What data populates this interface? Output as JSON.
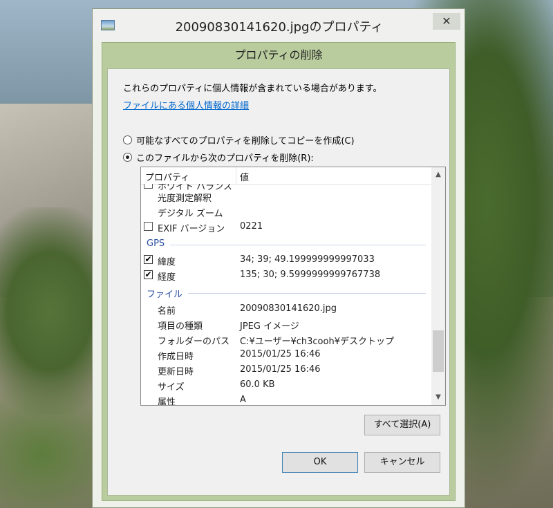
{
  "window": {
    "title": "20090830141620.jpgのプロパティ",
    "close_glyph": "✕"
  },
  "dialog": {
    "header": "プロパティの削除",
    "info_text": "これらのプロパティに個人情報が含まれている場合があります。",
    "details_link": "ファイルにある個人情報の詳細",
    "radio_copy": "可能なすべてのプロパティを削除してコピーを作成(C)",
    "radio_remove": "このファイルから次のプロパティを削除(R):",
    "selected_radio": "remove"
  },
  "list": {
    "col_property": "プロパティ",
    "col_value": "値",
    "partial_top_row": "ホワイト バランス",
    "rows_top": [
      {
        "name": "光度測定解釈",
        "value": "",
        "checkbox": false
      },
      {
        "name": "デジタル ズーム",
        "value": "",
        "checkbox": false
      },
      {
        "name": "EXIF バージョン",
        "value": "0221",
        "checkbox": true,
        "checked": false
      }
    ],
    "group_gps": "GPS",
    "rows_gps": [
      {
        "name": "緯度",
        "value": "34; 39; 49.199999999997033",
        "checked": true
      },
      {
        "name": "経度",
        "value": "135; 30; 9.5999999999767738",
        "checked": true
      }
    ],
    "group_file": "ファイル",
    "rows_file": [
      {
        "name": "名前",
        "value": "20090830141620.jpg"
      },
      {
        "name": "項目の種類",
        "value": "JPEG イメージ"
      },
      {
        "name": "フォルダーのパス",
        "value": "C:¥ユーザー¥ch3cooh¥デスクトップ"
      },
      {
        "name": "作成日時",
        "value": "2015/01/25 16:46"
      },
      {
        "name": "更新日時",
        "value": "2015/01/25 16:46"
      },
      {
        "name": "サイズ",
        "value": "60.0 KB"
      },
      {
        "name": "属性",
        "value": "A"
      }
    ],
    "scroll_up_glyph": "▲",
    "scroll_down_glyph": "▼"
  },
  "buttons": {
    "select_all": "すべて選択(A)",
    "ok": "OK",
    "cancel": "キャンセル"
  },
  "icons": {
    "window_icon": "image-file-icon",
    "close": "close-icon",
    "checkmark": "✔"
  }
}
